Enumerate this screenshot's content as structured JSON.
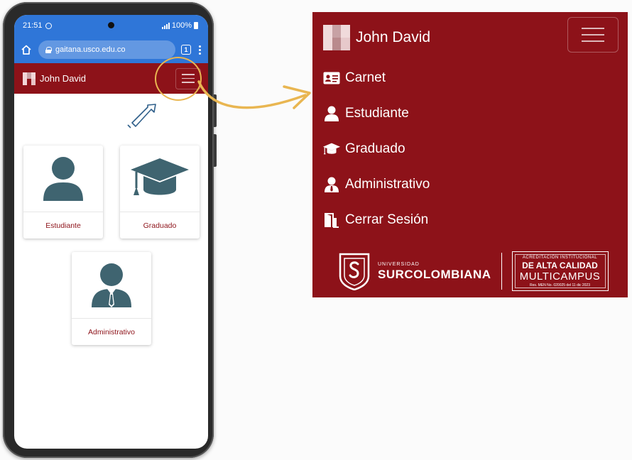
{
  "status_bar": {
    "time": "21:51",
    "battery": "100%"
  },
  "browser": {
    "url": "gaitana.usco.edu.co",
    "tab_count": "1"
  },
  "app_bar": {
    "user_name": "John David"
  },
  "cards": [
    {
      "label": "Estudiante",
      "icon": "user-icon"
    },
    {
      "label": "Graduado",
      "icon": "graduation-cap-icon"
    },
    {
      "label": "Administrativo",
      "icon": "user-tie-icon"
    }
  ],
  "menu": {
    "user_name": "John David",
    "items": [
      {
        "label": "Carnet",
        "icon": "id-card-icon"
      },
      {
        "label": "Estudiante",
        "icon": "user-icon"
      },
      {
        "label": "Graduado",
        "icon": "graduation-cap-icon"
      },
      {
        "label": "Administrativo",
        "icon": "user-tie-icon"
      },
      {
        "label": "Cerrar Sesión",
        "icon": "door-exit-icon"
      }
    ],
    "footer": {
      "uni_small": "UNIVERSIDAD",
      "uni_name": "SURCOLOMBIANA",
      "accred_line1": "ACREDITACIÓN INSTITUCIONAL",
      "accred_line2": "DE ALTA CALIDAD",
      "accred_line3": "MULTICAMPUS",
      "accred_line4": "Res. MEN No. 020025 del 11 dic 2023"
    }
  },
  "colors": {
    "brand_red": "#8d1219",
    "browser_blue": "#2f76d8",
    "icon_slate": "#3f6470",
    "highlight_gold": "#e9b651"
  }
}
